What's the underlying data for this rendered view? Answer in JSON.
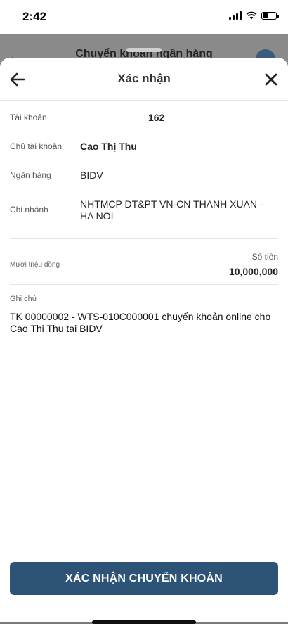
{
  "status_bar": {
    "time": "2:42"
  },
  "background_screen": {
    "title": "Chuyển khoản ngân hàng"
  },
  "header": {
    "title": "Xác nhận"
  },
  "details": {
    "account_label": "Tài khoản",
    "account_value": "162",
    "holder_label": "Chủ tài khoản",
    "holder_value": "Cao Thị Thu",
    "bank_label": "Ngân hàng",
    "bank_value": "BIDV",
    "branch_label": "Chi nhánh",
    "branch_value": "NHTMCP DT&PT VN-CN THANH XUAN - HA NOI"
  },
  "amount": {
    "words": "Mười triệu đồng",
    "label": "Số tiền",
    "value": "10,000,000"
  },
  "note": {
    "label": "Ghi chú",
    "text": "TK 00000002 - WTS-010C000001 chuyển khoản online cho Cao Thị Thu tại BIDV"
  },
  "actions": {
    "confirm_label": "XÁC NHẬN CHUYỂN KHOẢN"
  },
  "colors": {
    "primary": "#2d5377"
  }
}
